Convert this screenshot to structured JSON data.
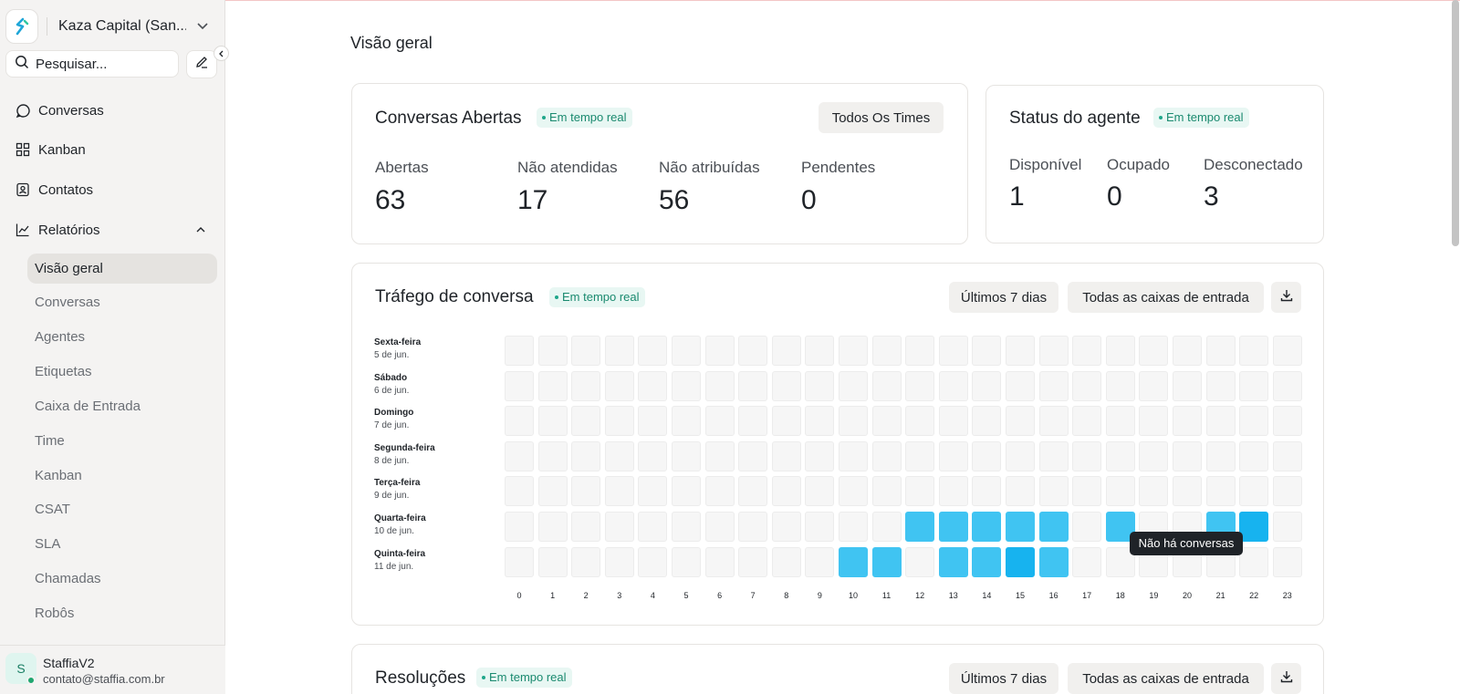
{
  "sidebar": {
    "account_name": "Kaza Capital (San...",
    "search_placeholder": "Pesquisar...",
    "nav": [
      {
        "label": "Conversas",
        "icon": "chat-icon"
      },
      {
        "label": "Kanban",
        "icon": "grid-icon"
      },
      {
        "label": "Contatos",
        "icon": "contacts-icon"
      },
      {
        "label": "Relatórios",
        "icon": "chart-icon"
      }
    ],
    "reports_sub": [
      "Visão geral",
      "Conversas",
      "Agentes",
      "Etiquetas",
      "Caixa de Entrada",
      "Time",
      "Kanban",
      "CSAT",
      "SLA",
      "Chamadas",
      "Robôs"
    ],
    "active_sub": "Visão geral",
    "user": {
      "initial": "S",
      "name": "StaffiaV2",
      "email": "contato@staffia.com.br"
    }
  },
  "main": {
    "page_title": "Visão geral",
    "open_conversations": {
      "title": "Conversas Abertas",
      "badge": "Em tempo real",
      "filter_button": "Todos Os Times",
      "metrics": [
        {
          "label": "Abertas",
          "value": "63"
        },
        {
          "label": "Não atendidas",
          "value": "17"
        },
        {
          "label": "Não atribuídas",
          "value": "56"
        },
        {
          "label": "Pendentes",
          "value": "0"
        }
      ]
    },
    "agent_status": {
      "title": "Status do agente",
      "badge": "Em tempo real",
      "metrics": [
        {
          "label": "Disponível",
          "value": "1"
        },
        {
          "label": "Ocupado",
          "value": "0"
        },
        {
          "label": "Desconectado",
          "value": "3"
        }
      ]
    },
    "traffic": {
      "title": "Tráfego de conversa",
      "badge": "Em tempo real",
      "period_button": "Últimos 7 dias",
      "inbox_button": "Todas as caixas de entrada",
      "tooltip": "Não há conversas",
      "days": [
        {
          "day": "Sexta-feira",
          "date": "5 de jun."
        },
        {
          "day": "Sábado",
          "date": "6 de jun."
        },
        {
          "day": "Domingo",
          "date": "7 de jun."
        },
        {
          "day": "Segunda-feira",
          "date": "8 de jun."
        },
        {
          "day": "Terça-feira",
          "date": "9 de jun."
        },
        {
          "day": "Quarta-feira",
          "date": "10 de jun."
        },
        {
          "day": "Quinta-feira",
          "date": "11 de jun."
        }
      ],
      "hours": [
        "0",
        "1",
        "2",
        "3",
        "4",
        "5",
        "6",
        "7",
        "8",
        "9",
        "10",
        "11",
        "12",
        "13",
        "14",
        "15",
        "16",
        "17",
        "18",
        "19",
        "20",
        "21",
        "22",
        "23"
      ],
      "active_cells": [
        {
          "row": 5,
          "hour": 12,
          "level": 0.7
        },
        {
          "row": 5,
          "hour": 13,
          "level": 0.7
        },
        {
          "row": 5,
          "hour": 14,
          "level": 0.7
        },
        {
          "row": 5,
          "hour": 15,
          "level": 0.7
        },
        {
          "row": 5,
          "hour": 16,
          "level": 0.7
        },
        {
          "row": 5,
          "hour": 18,
          "level": 0.7
        },
        {
          "row": 5,
          "hour": 21,
          "level": 0.7
        },
        {
          "row": 5,
          "hour": 22,
          "level": 0.9
        },
        {
          "row": 6,
          "hour": 10,
          "level": 0.7
        },
        {
          "row": 6,
          "hour": 11,
          "level": 0.7
        },
        {
          "row": 6,
          "hour": 13,
          "level": 0.7
        },
        {
          "row": 6,
          "hour": 14,
          "level": 0.7
        },
        {
          "row": 6,
          "hour": 15,
          "level": 0.9
        },
        {
          "row": 6,
          "hour": 16,
          "level": 0.7
        }
      ],
      "colors": {
        "strong": "#17b3ef",
        "medium": "#40c4f2",
        "empty": "#f6f6f6"
      }
    },
    "resolutions": {
      "title": "Resoluções",
      "badge": "Em tempo real",
      "period_button": "Últimos 7 dias",
      "inbox_button": "Todas as caixas de entrada"
    }
  }
}
